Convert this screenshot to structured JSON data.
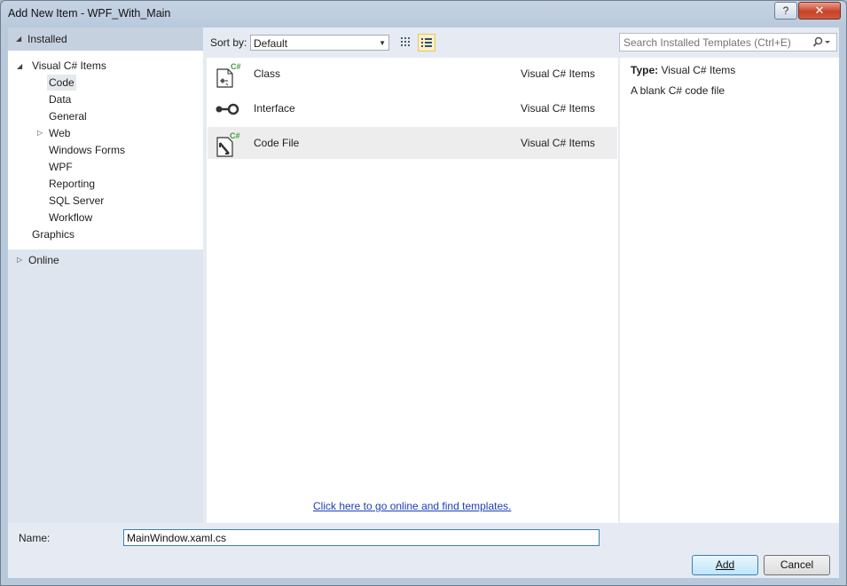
{
  "window": {
    "title": "Add New Item - WPF_With_Main",
    "help_label": "?",
    "close_label": "✕"
  },
  "tree": {
    "installed_label": "Installed",
    "root_label": "Visual C# Items",
    "children": [
      "Code",
      "Data",
      "General",
      "Web",
      "Windows Forms",
      "WPF",
      "Reporting",
      "SQL Server",
      "Workflow"
    ],
    "graphics_label": "Graphics",
    "online_label": "Online",
    "selected": "Code"
  },
  "toolbar": {
    "sort_label": "Sort by:",
    "sort_value": "Default",
    "search_placeholder": "Search Installed Templates (Ctrl+E)"
  },
  "templates": [
    {
      "name": "Class",
      "category": "Visual C# Items",
      "icon": "class-icon"
    },
    {
      "name": "Interface",
      "category": "Visual C# Items",
      "icon": "interface-icon"
    },
    {
      "name": "Code File",
      "category": "Visual C# Items",
      "icon": "code-file-icon",
      "selected": true
    }
  ],
  "online_link": "Click here to go online and find templates.",
  "details": {
    "type_label": "Type:",
    "type_value": "Visual C# Items",
    "description": "A blank C# code file"
  },
  "footer": {
    "name_label": "Name:",
    "name_value": "MainWindow.xaml.cs",
    "add_label": "Add",
    "cancel_label": "Cancel"
  },
  "colors": {
    "link": "#1a3fb8",
    "accent_green": "#3f9a3f",
    "focus_border": "#3c7fb1",
    "selection": "#ededed"
  }
}
